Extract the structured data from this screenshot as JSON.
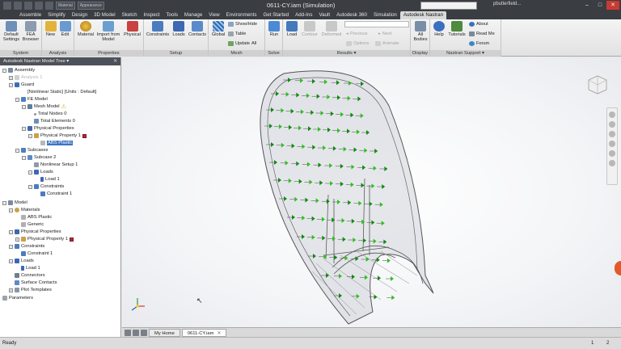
{
  "window": {
    "title": "0611-CY.iam (Simulation)",
    "quick_access": {
      "material_combo": "Material",
      "appearance_combo": "Appearance"
    },
    "sign_in": "pbutlerfield...",
    "controls": {
      "minimize": "–",
      "maximize": "□",
      "close": "✕"
    }
  },
  "tabs": [
    {
      "label": "Assemble"
    },
    {
      "label": "Simplify"
    },
    {
      "label": "Design"
    },
    {
      "label": "3D Model"
    },
    {
      "label": "Sketch"
    },
    {
      "label": "Inspect"
    },
    {
      "label": "Tools"
    },
    {
      "label": "Manage"
    },
    {
      "label": "View"
    },
    {
      "label": "Environments"
    },
    {
      "label": "Get Started"
    },
    {
      "label": "Add-Ins"
    },
    {
      "label": "Vault"
    },
    {
      "label": "Autodesk 360"
    },
    {
      "label": "Simulation"
    },
    {
      "label": "Autodesk Nastran"
    }
  ],
  "ribbon": {
    "system": {
      "label": "System",
      "default_settings": "Default Settings",
      "fea_browser": "FEA Browser"
    },
    "analysis": {
      "label": "Analysis",
      "new": "New",
      "edit": "Edit"
    },
    "properties": {
      "label": "Properties",
      "material": "Material",
      "import_from_model": "Import from Model",
      "physical": "Physical"
    },
    "setup": {
      "label": "Setup",
      "constraints": "Constraints",
      "loads": "Loads",
      "contacts": "Contacts"
    },
    "mesh": {
      "label": "Mesh",
      "global": "Global",
      "show_hide": "Show/Hide",
      "table": "Table",
      "update": "Update",
      "all": "All"
    },
    "solve": {
      "label": "Solve",
      "run": "Run"
    },
    "results": {
      "label": "Results ▾",
      "load": "Load",
      "contour": "Contour",
      "deformed": "Deformed",
      "previous": "Previous",
      "next": "Next",
      "options": "Options",
      "animate": "Animate"
    },
    "display": {
      "label": "Display",
      "all_bodies": "All Bodies"
    },
    "support": {
      "label": "Nastran Support ▾",
      "help": "Help",
      "tutorials": "Tutorials",
      "about": "About",
      "read_me": "Read Me",
      "forum": "Forum"
    }
  },
  "browser": {
    "header": "Autodesk Nastran Model Tree ▾",
    "close": "✕",
    "nodes": {
      "assembly": "Assembly",
      "analysis1": "Analysis 1",
      "guard": "Guard",
      "nonlinear_static": "[Nonlinear Static] [Units : Default]",
      "fe_model": "FE Model",
      "mesh_model": "Mesh Model",
      "total_nodes": "Total Nodes 0",
      "total_elements": "Total Elements 0",
      "physical_properties": "Physical Properties",
      "physical_property_1": "Physical Property 1",
      "abs_plastic_sel": "ABS Plastic",
      "subcases": "Subcases",
      "subcase_2": "Subcase 2",
      "nonlinear_setup_1": "Nonlinear Setup 1",
      "loads": "Loads",
      "load_1": "Load 1",
      "constraints": "Constraints",
      "constraint_1": "Constraint 1",
      "model": "Model",
      "materials": "Materials",
      "abs_plastic": "ABS Plastic",
      "generic": "Generic",
      "m_physical_properties": "Physical Properties",
      "m_physical_property_1": "Physical Property 1",
      "m_constraints": "Constraints",
      "m_constraint_1": "Constraint 1",
      "m_loads": "Loads",
      "m_load_1": "Load 1",
      "connectors": "Connectors",
      "surface_contacts": "Surface Contacts",
      "plot_templates": "Plot Templates",
      "parameters": "Parameters"
    }
  },
  "doc_tabs": [
    {
      "label": "My Home"
    },
    {
      "label": "0611-CY.iam"
    }
  ],
  "status": {
    "text": "Ready",
    "count1": "1",
    "count2": "2"
  },
  "colors": {
    "load_marker": "#2fbf1f",
    "load_marker_dark": "#0f8a10",
    "mesh_line": "#555555",
    "selection": "#3b74c4",
    "material_swatch": "#b42b3c"
  }
}
